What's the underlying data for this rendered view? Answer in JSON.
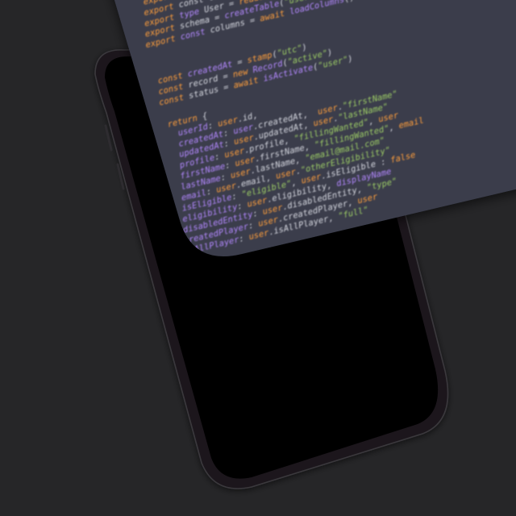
{
  "colors": {
    "background": "#262628",
    "phone_body": "#1a191b",
    "phone_screen": "#000000",
    "code_panel": "#3a3d4b",
    "syntax_keyword": "#ff9e3b",
    "syntax_string": "#9ccc65",
    "syntax_type": "#b388ff",
    "syntax_plain": "#d6d8e0",
    "syntax_comment": "#7e8296"
  },
  "code": {
    "block_a": [
      [
        [
          "k",
          "export"
        ],
        [
          "p",
          " "
        ],
        [
          "t",
          "field"
        ],
        [
          "p",
          " = "
        ],
        [
          "k",
          "new"
        ],
        [
          "p",
          " "
        ],
        [
          "s",
          "\"field\""
        ]
      ],
      [
        [
          "k",
          "export"
        ],
        [
          "p",
          " const "
        ],
        [
          "p",
          "table"
        ],
        [
          "p",
          " = "
        ],
        [
          "s",
          "\"table\""
        ],
        [
          "p",
          ";"
        ]
      ],
      [
        [
          "k",
          "export"
        ],
        [
          "p",
          " "
        ],
        [
          "t",
          "type"
        ],
        [
          "p",
          " "
        ],
        [
          "p",
          "User"
        ],
        [
          "p",
          " = "
        ],
        [
          "k",
          "readonly"
        ],
        [
          "p",
          " "
        ],
        [
          "t",
          "Entity"
        ]
      ],
      [
        [
          "k",
          "export"
        ],
        [
          "p",
          " "
        ],
        [
          "p",
          "schema"
        ],
        [
          "p",
          " = "
        ],
        [
          "t",
          "createTable"
        ],
        [
          "p",
          "("
        ],
        [
          "s",
          "\"users\""
        ],
        [
          "p",
          ", "
        ],
        [
          "s",
          "\"id\""
        ],
        [
          "p",
          ")"
        ]
      ],
      [
        [
          "k",
          "export"
        ],
        [
          "p",
          " "
        ],
        [
          "t",
          "const"
        ],
        [
          "p",
          " "
        ],
        [
          "p",
          "columns"
        ],
        [
          "p",
          " = "
        ],
        [
          "k",
          "await"
        ],
        [
          "p",
          " "
        ],
        [
          "t",
          "loadColumns"
        ],
        [
          "p",
          "()"
        ]
      ]
    ],
    "block_b": [
      [
        [
          "k",
          "const"
        ],
        [
          "p",
          " "
        ],
        [
          "t",
          "createdAt"
        ],
        [
          "p",
          " = "
        ],
        [
          "k",
          "stamp"
        ],
        [
          "p",
          "("
        ],
        [
          "s",
          "\"utc\""
        ],
        [
          "p",
          ")"
        ]
      ],
      [
        [
          "k",
          "const"
        ],
        [
          "p",
          " "
        ],
        [
          "p",
          "record"
        ],
        [
          "p",
          " = "
        ],
        [
          "k",
          "new"
        ],
        [
          "p",
          " "
        ],
        [
          "t",
          "Record"
        ],
        [
          "p",
          "("
        ],
        [
          "s",
          "\"active\""
        ],
        [
          "p",
          ")"
        ]
      ],
      [
        [
          "k",
          "const"
        ],
        [
          "p",
          " "
        ],
        [
          "p",
          "status"
        ],
        [
          "p",
          " = "
        ],
        [
          "k",
          "await"
        ],
        [
          "p",
          " "
        ],
        [
          "t",
          "isActivate"
        ],
        [
          "p",
          "("
        ],
        [
          "s",
          "\"user\""
        ],
        [
          "p",
          ")"
        ]
      ]
    ],
    "block_c": [
      [
        [
          "k",
          "return"
        ],
        [
          "p",
          " {"
        ]
      ],
      [
        [
          "p",
          "  "
        ],
        [
          "t",
          "userId"
        ],
        [
          "p",
          ": "
        ],
        [
          "k",
          "user"
        ],
        [
          "p",
          "."
        ],
        [
          "p",
          "id"
        ],
        [
          "p",
          ","
        ]
      ],
      [
        [
          "p",
          "  "
        ],
        [
          "t",
          "createdAt"
        ],
        [
          "p",
          ": "
        ],
        [
          "t",
          "user"
        ],
        [
          "p",
          "."
        ],
        [
          "p",
          "createdAt"
        ],
        [
          "p",
          ","
        ],
        [
          "p",
          "  "
        ],
        [
          "k",
          "user"
        ],
        [
          "p",
          "."
        ],
        [
          "s",
          "\"firstName\""
        ]
      ],
      [
        [
          "p",
          "  "
        ],
        [
          "t",
          "updatedAt"
        ],
        [
          "p",
          ": "
        ],
        [
          "k",
          "user"
        ],
        [
          "p",
          "."
        ],
        [
          "p",
          "updatedAt"
        ],
        [
          "p",
          ", "
        ],
        [
          "k",
          "user"
        ],
        [
          "p",
          "."
        ],
        [
          "s",
          "\"lastName\""
        ]
      ],
      [
        [
          "p",
          "  "
        ],
        [
          "t",
          "profile"
        ],
        [
          "p",
          ": "
        ],
        [
          "k",
          "user"
        ],
        [
          "p",
          "."
        ],
        [
          "p",
          "profile"
        ],
        [
          "p",
          ", "
        ],
        [
          "s",
          "\"fillingWanted\""
        ],
        [
          "p",
          ", "
        ],
        [
          "k",
          "user"
        ]
      ],
      [
        [
          "p",
          "  "
        ],
        [
          "t",
          "firstName"
        ],
        [
          "p",
          ": "
        ],
        [
          "k",
          "user"
        ],
        [
          "p",
          "."
        ],
        [
          "p",
          "firstName"
        ],
        [
          "p",
          ", "
        ],
        [
          "s",
          "\"fillingWanted\""
        ],
        [
          "p",
          ", "
        ],
        [
          "k",
          "email"
        ]
      ],
      [
        [
          "p",
          "  "
        ],
        [
          "t",
          "lastName"
        ],
        [
          "p",
          ": "
        ],
        [
          "k",
          "user"
        ],
        [
          "p",
          "."
        ],
        [
          "p",
          "lastName"
        ],
        [
          "p",
          ", "
        ],
        [
          "s",
          "\"email@mail.com\""
        ]
      ],
      [
        [
          "p",
          "  "
        ],
        [
          "t",
          "email"
        ],
        [
          "p",
          ": "
        ],
        [
          "k",
          "user"
        ],
        [
          "p",
          "."
        ],
        [
          "p",
          "email"
        ],
        [
          "p",
          ", "
        ],
        [
          "k",
          "user"
        ],
        [
          "p",
          "."
        ],
        [
          "s",
          "\"otherEligibility\""
        ]
      ],
      [
        [
          "p",
          "  "
        ],
        [
          "t",
          "isEligible"
        ],
        [
          "p",
          ": "
        ],
        [
          "s",
          "\"eligible\""
        ],
        [
          "p",
          ", "
        ],
        [
          "k",
          "user"
        ],
        [
          "p",
          "."
        ],
        [
          "p",
          "isEligible"
        ],
        [
          "p",
          " : "
        ],
        [
          "k",
          "false"
        ]
      ],
      [
        [
          "p",
          "  "
        ],
        [
          "t",
          "eligibility"
        ],
        [
          "p",
          ": "
        ],
        [
          "k",
          "user"
        ],
        [
          "p",
          "."
        ],
        [
          "p",
          "eligibility"
        ],
        [
          "p",
          ", "
        ],
        [
          "t",
          "displayName"
        ]
      ],
      [
        [
          "p",
          "  "
        ],
        [
          "t",
          "disabledEntity"
        ],
        [
          "p",
          ": "
        ],
        [
          "k",
          "user"
        ],
        [
          "p",
          "."
        ],
        [
          "p",
          "disabledEntity"
        ],
        [
          "p",
          ", "
        ],
        [
          "s",
          "\"type\""
        ]
      ],
      [
        [
          "p",
          "  "
        ],
        [
          "t",
          "createdPlayer"
        ],
        [
          "p",
          ": "
        ],
        [
          "k",
          "user"
        ],
        [
          "p",
          "."
        ],
        [
          "p",
          "createdPlayer"
        ],
        [
          "p",
          ", "
        ],
        [
          "k",
          "user"
        ]
      ],
      [
        [
          "p",
          "  "
        ],
        [
          "t",
          "isAllPlayer"
        ],
        [
          "p",
          ": "
        ],
        [
          "k",
          "user"
        ],
        [
          "p",
          "."
        ],
        [
          "p",
          "isAllPlayer"
        ],
        [
          "p",
          ", "
        ],
        [
          "s",
          "\"full\""
        ]
      ]
    ]
  }
}
